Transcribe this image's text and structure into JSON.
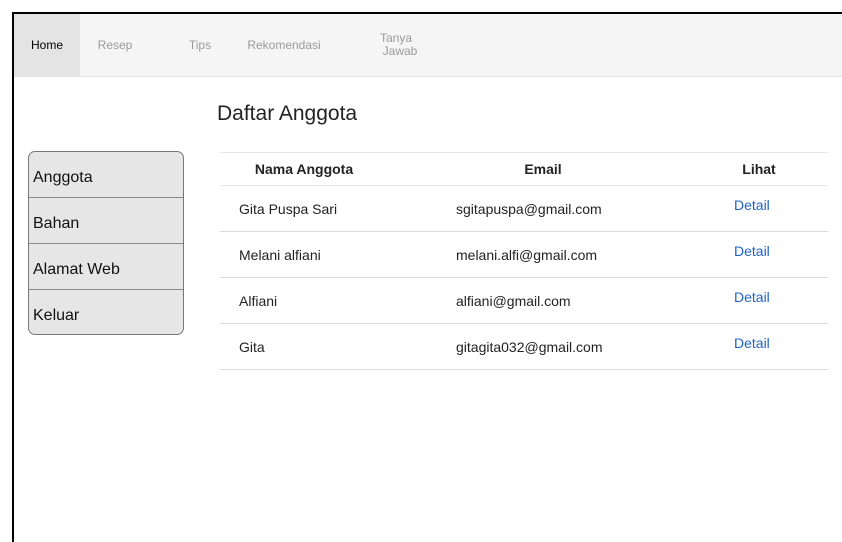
{
  "nav": {
    "tabs": [
      {
        "label": "Home",
        "active": true
      },
      {
        "label": "Resep",
        "active": false
      },
      {
        "label": "Tips",
        "active": false
      },
      {
        "label": "Rekomendasi",
        "active": false
      },
      {
        "label_line1": "Tanya",
        "label_line2": "Jawab",
        "active": false
      }
    ]
  },
  "page": {
    "title": "Daftar Anggota"
  },
  "sidebar": {
    "items": [
      {
        "label": "Anggota"
      },
      {
        "label": "Bahan"
      },
      {
        "label": "Alamat Web"
      },
      {
        "label": "Keluar"
      }
    ]
  },
  "table": {
    "headers": [
      "Nama Anggota",
      "Email",
      "Lihat"
    ],
    "rows": [
      {
        "name": "Gita Puspa Sari",
        "email": "sgitapuspa@gmail.com",
        "action": "Detail"
      },
      {
        "name": "Melani alfiani",
        "email": "melani.alfi@gmail.com",
        "action": "Detail"
      },
      {
        "name": "Alfiani",
        "email": "alfiani@gmail.com",
        "action": "Detail"
      },
      {
        "name": "Gita",
        "email": "gitagita032@gmail.com",
        "action": "Detail"
      }
    ]
  },
  "colors": {
    "link": "#1f63c6",
    "active_tab_bg": "#e4e4e4",
    "sidebar_bg": "#e6e6e6"
  }
}
